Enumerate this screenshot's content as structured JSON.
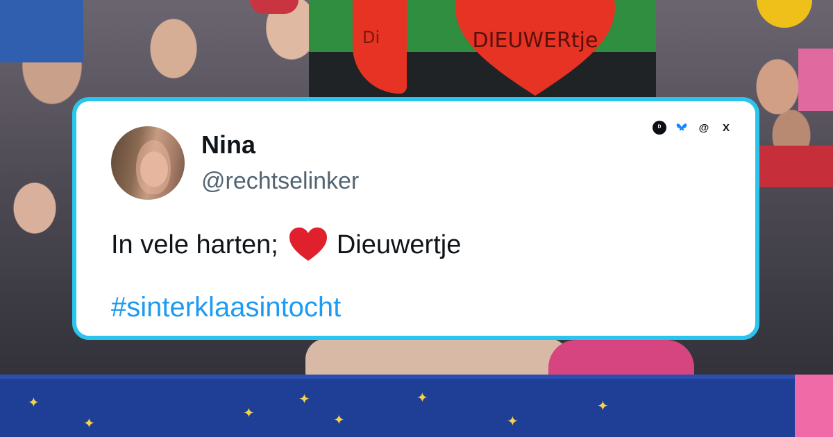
{
  "sign": {
    "text": "DIEUWERtje",
    "partial_text": "Di"
  },
  "tweet": {
    "name": "Nina",
    "handle": "@rechtselinker",
    "text_before": "In vele harten;",
    "emoji": "red-heart",
    "text_after": "Dieuwertje",
    "hashtag": "#sinterklaasintocht"
  },
  "social_icons": [
    {
      "name": "d-app-icon",
      "glyph": "ᴰ"
    },
    {
      "name": "bluesky-icon"
    },
    {
      "name": "threads-icon",
      "glyph": "@"
    },
    {
      "name": "x-icon",
      "glyph": "X"
    }
  ],
  "colors": {
    "card_border": "#29c5ee",
    "hashtag": "#1d9bf0",
    "name": "#0f1419",
    "handle": "#536471",
    "heart": "#e0202c"
  }
}
